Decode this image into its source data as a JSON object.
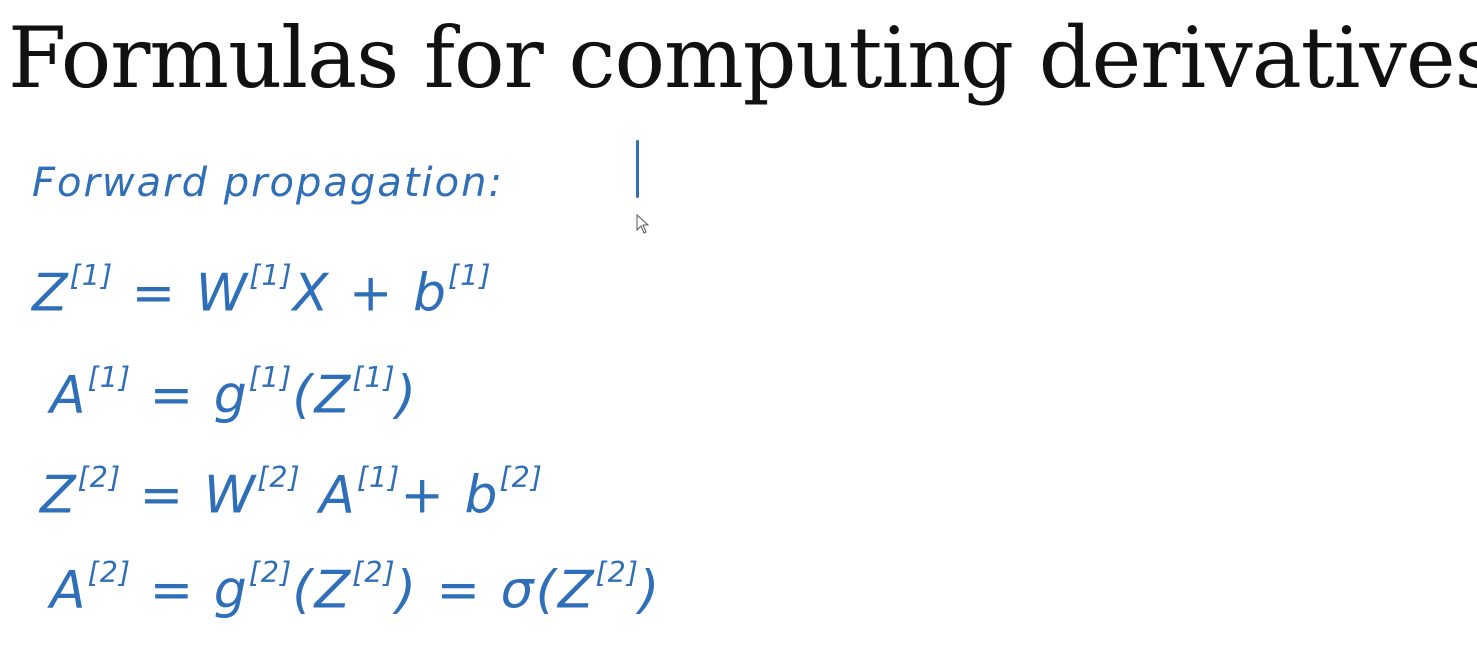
{
  "slide": {
    "title": "Formulas for computing derivatives"
  },
  "notes": {
    "heading": "Forward propagation:",
    "equations": [
      {
        "lhs": "Z",
        "lhs_sup": "[1]",
        "eq": " = ",
        "rhs_a": "W",
        "rhs_a_sup": "[1]",
        "rhs_b": "X + b",
        "rhs_b_sup": "[1]"
      },
      {
        "lhs": "A",
        "lhs_sup": "[1]",
        "eq": " = ",
        "rhs_a": "g",
        "rhs_a_sup": "[1]",
        "rhs_b": "(Z",
        "rhs_b_sup": "[1]",
        "rhs_c": ")"
      },
      {
        "lhs": "Z",
        "lhs_sup": "[2]",
        "eq": " = ",
        "rhs_a": "W",
        "rhs_a_sup": "[2]",
        "rhs_b": " A",
        "rhs_b_sup": "[1]",
        "rhs_c": "+ b",
        "rhs_c_sup": "[2]"
      },
      {
        "lhs": "A",
        "lhs_sup": "[2]",
        "eq": " = ",
        "rhs_a": "g",
        "rhs_a_sup": "[2]",
        "rhs_b": "(Z",
        "rhs_b_sup": "[2]",
        "rhs_c": ") = σ(Z",
        "rhs_c_sup": "[2]",
        "rhs_d": ")"
      }
    ]
  },
  "colors": {
    "ink": "#2f6fb8",
    "title": "#111111",
    "background": "#ffffff"
  },
  "icons": {
    "pen_cursor": "pen-cursor-icon",
    "pointer": "mouse-pointer-icon"
  }
}
